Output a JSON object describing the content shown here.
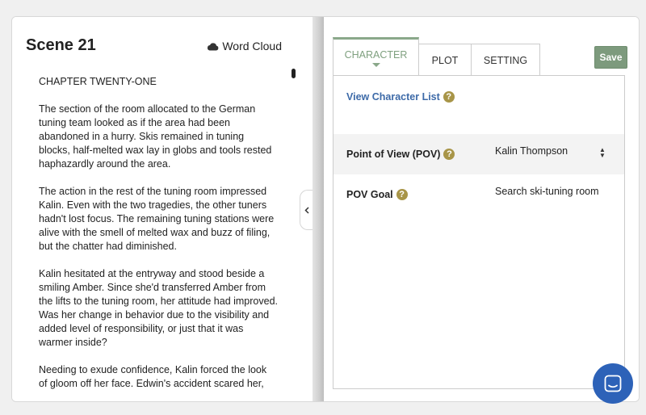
{
  "left_pane": {
    "scene_title": "Scene 21",
    "word_cloud_label": "Word Cloud",
    "chapter_heading": "CHAPTER TWENTY-ONE",
    "paragraphs": [
      "The section of the room allocated to the German tuning team looked as if the area had been abandoned in a hurry. Skis remained in tuning blocks, half-melted wax lay in globs and tools rested haphazardly around the area.",
      "The action in the rest of the tuning room impressed Kalin. Even with the two tragedies, the other tuners hadn't lost focus. The remaining tuning stations were alive with the smell of melted wax and buzz of filing, but the chatter had diminished.",
      "Kalin hesitated at the entryway and stood beside a smiling Amber. Since she'd transferred Amber from the lifts to the tuning room, her attitude had improved. Was her change in behavior due to the visibility and added level of responsibility, or just that it was warmer inside?",
      "Needing to exude confidence, Kalin forced the look of gloom off her face. Edwin's accident scared her, but she"
    ]
  },
  "right_pane": {
    "tabs": [
      {
        "label": "Character",
        "active": true
      },
      {
        "label": "Plot",
        "active": false
      },
      {
        "label": "Setting",
        "active": false
      }
    ],
    "save_label": "Save",
    "view_character_list": "View Character List",
    "help_glyph": "?",
    "pov_label": "Point of View (POV)",
    "pov_value": "Kalin Thompson",
    "pov_goal_label": "POV Goal",
    "pov_goal_value": "Search ski-tuning room"
  },
  "colors": {
    "accent_green": "#8aa88a",
    "save_green": "#7d9a7d",
    "link_blue": "#3d6aa8",
    "help_gold": "#a89548",
    "chat_blue": "#2d62b8"
  },
  "icons": [
    "cloud-icon",
    "chevron-left-icon",
    "help-icon",
    "select-arrows-icon",
    "chat-icon"
  ]
}
